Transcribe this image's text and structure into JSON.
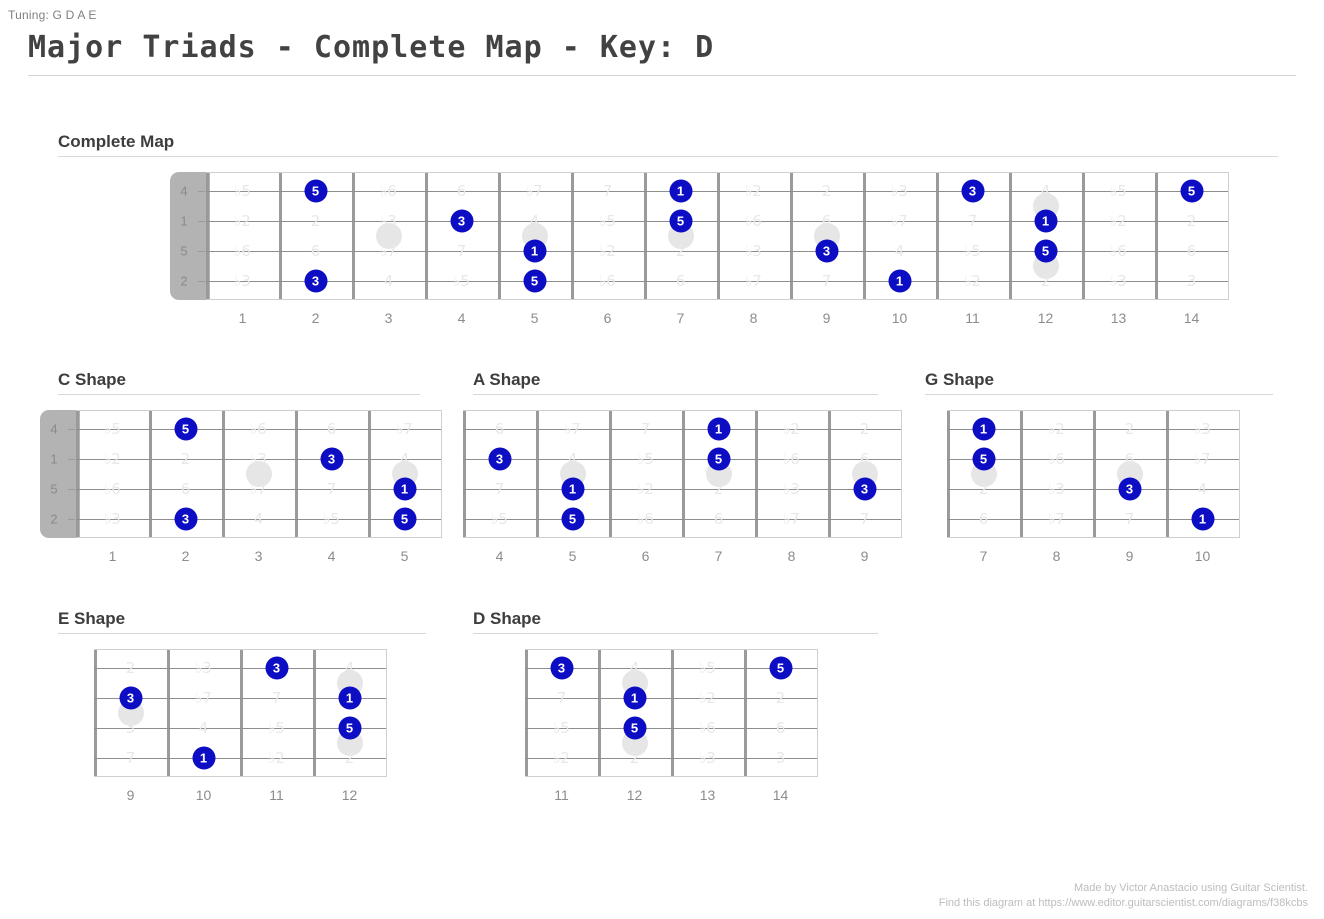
{
  "tuning_label": "Tuning: G D A E",
  "title": "Major Triads - Complete Map - Key: D",
  "colors": {
    "marker": "#0d0dc4",
    "interval_text": "#e8e8e8",
    "nut": "#b3b3b3",
    "fret": "#9a9a9a"
  },
  "footer": {
    "line1": "Made by Victor Anastacio using Guitar Scientist.",
    "line2": "Find this diagram at https://www.editor.guitarscientist.com/diagrams/f38kcbs"
  },
  "sections": [
    {
      "id": "complete-map",
      "title": "Complete Map",
      "show_nut": true,
      "open_labels": [
        "4",
        "1",
        "5",
        "2"
      ],
      "frets": [
        1,
        2,
        3,
        4,
        5,
        6,
        7,
        8,
        9,
        10,
        11,
        12,
        13,
        14
      ],
      "inlays": [
        {
          "fret": 3,
          "gap": 1
        },
        {
          "fret": 5,
          "gap": 1
        },
        {
          "fret": 7,
          "gap": 1
        },
        {
          "fret": 9,
          "gap": 1
        },
        {
          "fret": 12,
          "gap": 0
        },
        {
          "fret": 12,
          "gap": 2
        }
      ],
      "intervals": [
        [
          "b5",
          "5",
          "b6",
          "6",
          "b7",
          "7",
          "1",
          "b2",
          "2",
          "b3",
          "3",
          "4",
          "b5",
          "5"
        ],
        [
          "b2",
          "2",
          "b3",
          "3",
          "4",
          "b5",
          "5",
          "b6",
          "6",
          "b7",
          "7",
          "1",
          "b2",
          "2"
        ],
        [
          "b6",
          "6",
          "b7",
          "7",
          "1",
          "b2",
          "2",
          "b3",
          "3",
          "4",
          "b5",
          "5",
          "b6",
          "6"
        ],
        [
          "b3",
          "3",
          "4",
          "b5",
          "5",
          "b6",
          "6",
          "b7",
          "7",
          "1",
          "b2",
          "2",
          "b3",
          "3"
        ]
      ],
      "markers": [
        {
          "string": 0,
          "fret": 2,
          "label": "5"
        },
        {
          "string": 0,
          "fret": 7,
          "label": "1"
        },
        {
          "string": 0,
          "fret": 11,
          "label": "3"
        },
        {
          "string": 0,
          "fret": 14,
          "label": "5"
        },
        {
          "string": 1,
          "fret": 4,
          "label": "3"
        },
        {
          "string": 1,
          "fret": 7,
          "label": "5"
        },
        {
          "string": 1,
          "fret": 12,
          "label": "1"
        },
        {
          "string": 2,
          "fret": 5,
          "label": "1"
        },
        {
          "string": 2,
          "fret": 9,
          "label": "3"
        },
        {
          "string": 2,
          "fret": 12,
          "label": "5"
        },
        {
          "string": 3,
          "fret": 2,
          "label": "3"
        },
        {
          "string": 3,
          "fret": 5,
          "label": "5"
        },
        {
          "string": 3,
          "fret": 10,
          "label": "1"
        }
      ]
    },
    {
      "id": "c-shape",
      "title": "C Shape",
      "show_nut": true,
      "open_labels": [
        "4",
        "1",
        "5",
        "2"
      ],
      "frets": [
        1,
        2,
        3,
        4,
        5
      ],
      "inlays": [
        {
          "fret": 3,
          "gap": 1
        },
        {
          "fret": 5,
          "gap": 1
        }
      ],
      "intervals": [
        [
          "b5",
          "5",
          "b6",
          "6",
          "b7"
        ],
        [
          "b2",
          "2",
          "b3",
          "3",
          "4"
        ],
        [
          "b6",
          "6",
          "b7",
          "7",
          "1"
        ],
        [
          "b3",
          "3",
          "4",
          "b5",
          "5"
        ]
      ],
      "markers": [
        {
          "string": 0,
          "fret": 2,
          "label": "5"
        },
        {
          "string": 1,
          "fret": 4,
          "label": "3"
        },
        {
          "string": 2,
          "fret": 5,
          "label": "1"
        },
        {
          "string": 3,
          "fret": 2,
          "label": "3"
        },
        {
          "string": 3,
          "fret": 5,
          "label": "5"
        }
      ]
    },
    {
      "id": "a-shape",
      "title": "A Shape",
      "show_nut": false,
      "open_labels": [],
      "frets": [
        4,
        5,
        6,
        7,
        8,
        9
      ],
      "inlays": [
        {
          "fret": 5,
          "gap": 1
        },
        {
          "fret": 7,
          "gap": 1
        },
        {
          "fret": 9,
          "gap": 1
        }
      ],
      "intervals": [
        [
          "6",
          "b7",
          "7",
          "1",
          "b2",
          "2"
        ],
        [
          "3",
          "4",
          "b5",
          "5",
          "b6",
          "6"
        ],
        [
          "7",
          "1",
          "b2",
          "2",
          "b3",
          "3"
        ],
        [
          "b5",
          "5",
          "b6",
          "6",
          "b7",
          "7"
        ]
      ],
      "markers": [
        {
          "string": 0,
          "fret": 7,
          "label": "1"
        },
        {
          "string": 1,
          "fret": 4,
          "label": "3"
        },
        {
          "string": 1,
          "fret": 7,
          "label": "5"
        },
        {
          "string": 2,
          "fret": 5,
          "label": "1"
        },
        {
          "string": 2,
          "fret": 9,
          "label": "3"
        },
        {
          "string": 3,
          "fret": 5,
          "label": "5"
        }
      ]
    },
    {
      "id": "g-shape",
      "title": "G Shape",
      "show_nut": false,
      "open_labels": [],
      "frets": [
        7,
        8,
        9,
        10
      ],
      "inlays": [
        {
          "fret": 7,
          "gap": 1
        },
        {
          "fret": 9,
          "gap": 1
        }
      ],
      "intervals": [
        [
          "1",
          "b2",
          "2",
          "b3"
        ],
        [
          "5",
          "b6",
          "6",
          "b7"
        ],
        [
          "2",
          "b3",
          "3",
          "4"
        ],
        [
          "6",
          "b7",
          "7",
          "1"
        ]
      ],
      "markers": [
        {
          "string": 0,
          "fret": 7,
          "label": "1"
        },
        {
          "string": 1,
          "fret": 7,
          "label": "5"
        },
        {
          "string": 2,
          "fret": 9,
          "label": "3"
        },
        {
          "string": 3,
          "fret": 10,
          "label": "1"
        }
      ]
    },
    {
      "id": "e-shape",
      "title": "E Shape",
      "show_nut": false,
      "open_labels": [],
      "frets": [
        9,
        10,
        11,
        12
      ],
      "inlays": [
        {
          "fret": 9,
          "gap": 1
        },
        {
          "fret": 12,
          "gap": 0
        },
        {
          "fret": 12,
          "gap": 2
        }
      ],
      "intervals": [
        [
          "2",
          "b3",
          "3",
          "4"
        ],
        [
          "6",
          "b7",
          "7",
          "1"
        ],
        [
          "3",
          "4",
          "b5",
          "5"
        ],
        [
          "7",
          "1",
          "b2",
          "2"
        ]
      ],
      "markers": [
        {
          "string": 0,
          "fret": 11,
          "label": "3"
        },
        {
          "string": 1,
          "fret": 9,
          "label": "3"
        },
        {
          "string": 1,
          "fret": 12,
          "label": "1"
        },
        {
          "string": 2,
          "fret": 12,
          "label": "5"
        },
        {
          "string": 3,
          "fret": 10,
          "label": "1"
        }
      ]
    },
    {
      "id": "d-shape",
      "title": "D Shape",
      "show_nut": false,
      "open_labels": [],
      "frets": [
        11,
        12,
        13,
        14
      ],
      "inlays": [
        {
          "fret": 12,
          "gap": 0
        },
        {
          "fret": 12,
          "gap": 2
        }
      ],
      "intervals": [
        [
          "3",
          "4",
          "b5",
          "5"
        ],
        [
          "7",
          "1",
          "b2",
          "2"
        ],
        [
          "b5",
          "5",
          "b6",
          "6"
        ],
        [
          "b2",
          "2",
          "b3",
          "3"
        ]
      ],
      "markers": [
        {
          "string": 0,
          "fret": 11,
          "label": "3"
        },
        {
          "string": 0,
          "fret": 14,
          "label": "5"
        },
        {
          "string": 1,
          "fret": 12,
          "label": "1"
        },
        {
          "string": 2,
          "fret": 12,
          "label": "5"
        }
      ]
    }
  ]
}
